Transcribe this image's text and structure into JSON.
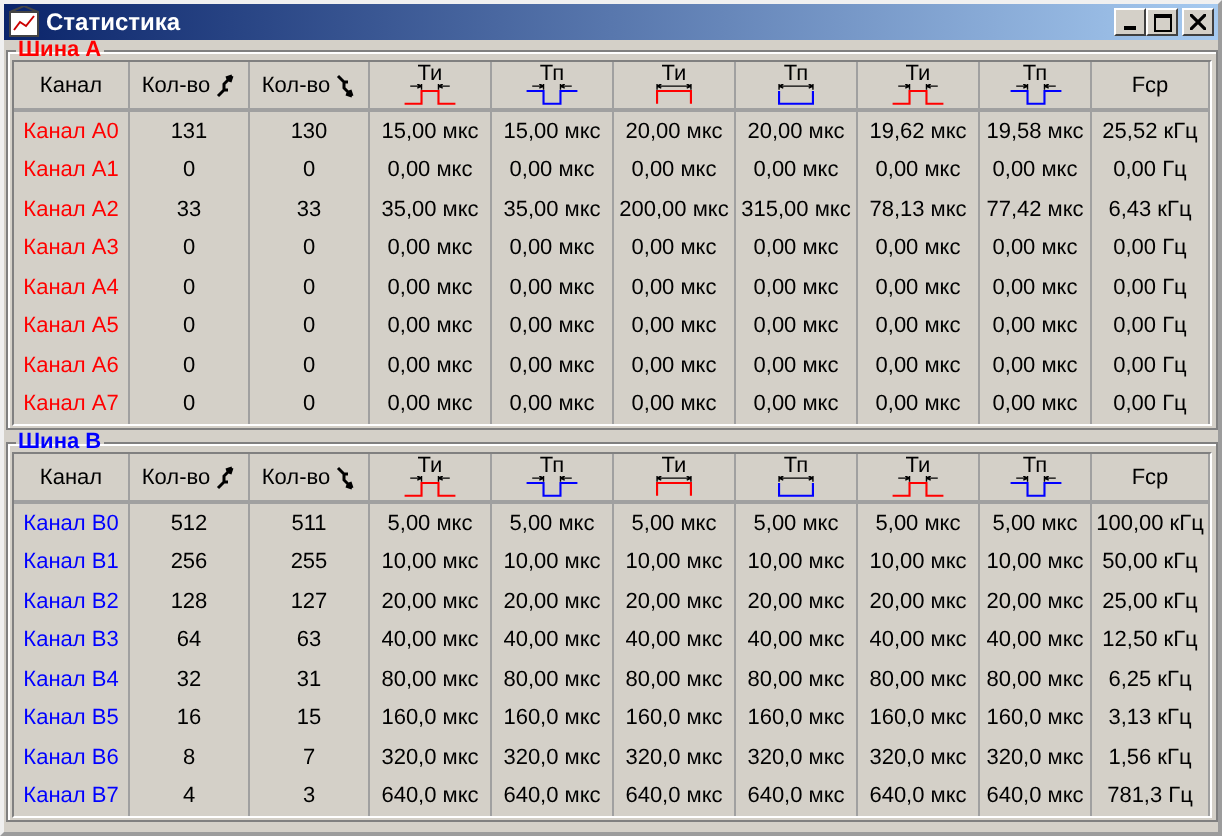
{
  "window": {
    "title": "Статистика"
  },
  "groups": [
    {
      "label": "Шина А",
      "color": "#ff0000",
      "columns": [
        {
          "kind": "text",
          "label": "Канал"
        },
        {
          "kind": "rising",
          "label": "Кол-во"
        },
        {
          "kind": "falling",
          "label": "Кол-во"
        },
        {
          "kind": "pulse",
          "label": "Ти",
          "wide": false
        },
        {
          "kind": "pause",
          "label": "Тп",
          "wide": false
        },
        {
          "kind": "pulse",
          "label": "Ти",
          "wide": true
        },
        {
          "kind": "pause",
          "label": "Тп",
          "wide": true
        },
        {
          "kind": "pulse",
          "label": "Ти",
          "wide": false
        },
        {
          "kind": "pause",
          "label": "Тп",
          "wide": false
        },
        {
          "kind": "text",
          "label": "Fср"
        }
      ],
      "rows": [
        {
          "name": "Канал А0",
          "values": [
            "131",
            "130",
            "15,00 мкс",
            "15,00 мкс",
            "20,00 мкс",
            "20,00 мкс",
            "19,62 мкс",
            "19,58 мкс",
            "25,52 кГц"
          ]
        },
        {
          "name": "Канал А1",
          "values": [
            "0",
            "0",
            "0,00 мкс",
            "0,00 мкс",
            "0,00 мкс",
            "0,00 мкс",
            "0,00 мкс",
            "0,00 мкс",
            "0,00 Гц"
          ]
        },
        {
          "name": "Канал А2",
          "values": [
            "33",
            "33",
            "35,00 мкс",
            "35,00 мкс",
            "200,00 мкс",
            "315,00 мкс",
            "78,13 мкс",
            "77,42 мкс",
            "6,43 кГц"
          ]
        },
        {
          "name": "Канал А3",
          "values": [
            "0",
            "0",
            "0,00 мкс",
            "0,00 мкс",
            "0,00 мкс",
            "0,00 мкс",
            "0,00 мкс",
            "0,00 мкс",
            "0,00 Гц"
          ]
        },
        {
          "name": "Канал А4",
          "values": [
            "0",
            "0",
            "0,00 мкс",
            "0,00 мкс",
            "0,00 мкс",
            "0,00 мкс",
            "0,00 мкс",
            "0,00 мкс",
            "0,00 Гц"
          ]
        },
        {
          "name": "Канал А5",
          "values": [
            "0",
            "0",
            "0,00 мкс",
            "0,00 мкс",
            "0,00 мкс",
            "0,00 мкс",
            "0,00 мкс",
            "0,00 мкс",
            "0,00 Гц"
          ]
        },
        {
          "name": "Канал А6",
          "values": [
            "0",
            "0",
            "0,00 мкс",
            "0,00 мкс",
            "0,00 мкс",
            "0,00 мкс",
            "0,00 мкс",
            "0,00 мкс",
            "0,00 Гц"
          ]
        },
        {
          "name": "Канал А7",
          "values": [
            "0",
            "0",
            "0,00 мкс",
            "0,00 мкс",
            "0,00 мкс",
            "0,00 мкс",
            "0,00 мкс",
            "0,00 мкс",
            "0,00 Гц"
          ]
        }
      ]
    },
    {
      "label": "Шина В",
      "color": "#0000ff",
      "columns": [
        {
          "kind": "text",
          "label": "Канал"
        },
        {
          "kind": "rising",
          "label": "Кол-во"
        },
        {
          "kind": "falling",
          "label": "Кол-во"
        },
        {
          "kind": "pulse",
          "label": "Ти",
          "wide": false
        },
        {
          "kind": "pause",
          "label": "Тп",
          "wide": false
        },
        {
          "kind": "pulse",
          "label": "Ти",
          "wide": true
        },
        {
          "kind": "pause",
          "label": "Тп",
          "wide": true
        },
        {
          "kind": "pulse",
          "label": "Ти",
          "wide": false
        },
        {
          "kind": "pause",
          "label": "Тп",
          "wide": false
        },
        {
          "kind": "text",
          "label": "Fср"
        }
      ],
      "rows": [
        {
          "name": "Канал В0",
          "values": [
            "512",
            "511",
            "5,00 мкс",
            "5,00 мкс",
            "5,00 мкс",
            "5,00 мкс",
            "5,00 мкс",
            "5,00 мкс",
            "100,00 кГц"
          ]
        },
        {
          "name": "Канал В1",
          "values": [
            "256",
            "255",
            "10,00 мкс",
            "10,00 мкс",
            "10,00 мкс",
            "10,00 мкс",
            "10,00 мкс",
            "10,00 мкс",
            "50,00 кГц"
          ]
        },
        {
          "name": "Канал В2",
          "values": [
            "128",
            "127",
            "20,00 мкс",
            "20,00 мкс",
            "20,00 мкс",
            "20,00 мкс",
            "20,00 мкс",
            "20,00 мкс",
            "25,00 кГц"
          ]
        },
        {
          "name": "Канал В3",
          "values": [
            "64",
            "63",
            "40,00 мкс",
            "40,00 мкс",
            "40,00 мкс",
            "40,00 мкс",
            "40,00 мкс",
            "40,00 мкс",
            "12,50 кГц"
          ]
        },
        {
          "name": "Канал В4",
          "values": [
            "32",
            "31",
            "80,00 мкс",
            "80,00 мкс",
            "80,00 мкс",
            "80,00 мкс",
            "80,00 мкс",
            "80,00 мкс",
            "6,25 кГц"
          ]
        },
        {
          "name": "Канал В5",
          "values": [
            "16",
            "15",
            "160,0 мкс",
            "160,0 мкс",
            "160,0 мкс",
            "160,0 мкс",
            "160,0 мкс",
            "160,0 мкс",
            "3,13 кГц"
          ]
        },
        {
          "name": "Канал В6",
          "values": [
            "8",
            "7",
            "320,0 мкс",
            "320,0 мкс",
            "320,0 мкс",
            "320,0 мкс",
            "320,0 мкс",
            "320,0 мкс",
            "1,56 кГц"
          ]
        },
        {
          "name": "Канал В7",
          "values": [
            "4",
            "3",
            "640,0 мкс",
            "640,0 мкс",
            "640,0 мкс",
            "640,0 мкс",
            "640,0 мкс",
            "640,0 мкс",
            "781,3 Гц"
          ]
        }
      ]
    }
  ]
}
